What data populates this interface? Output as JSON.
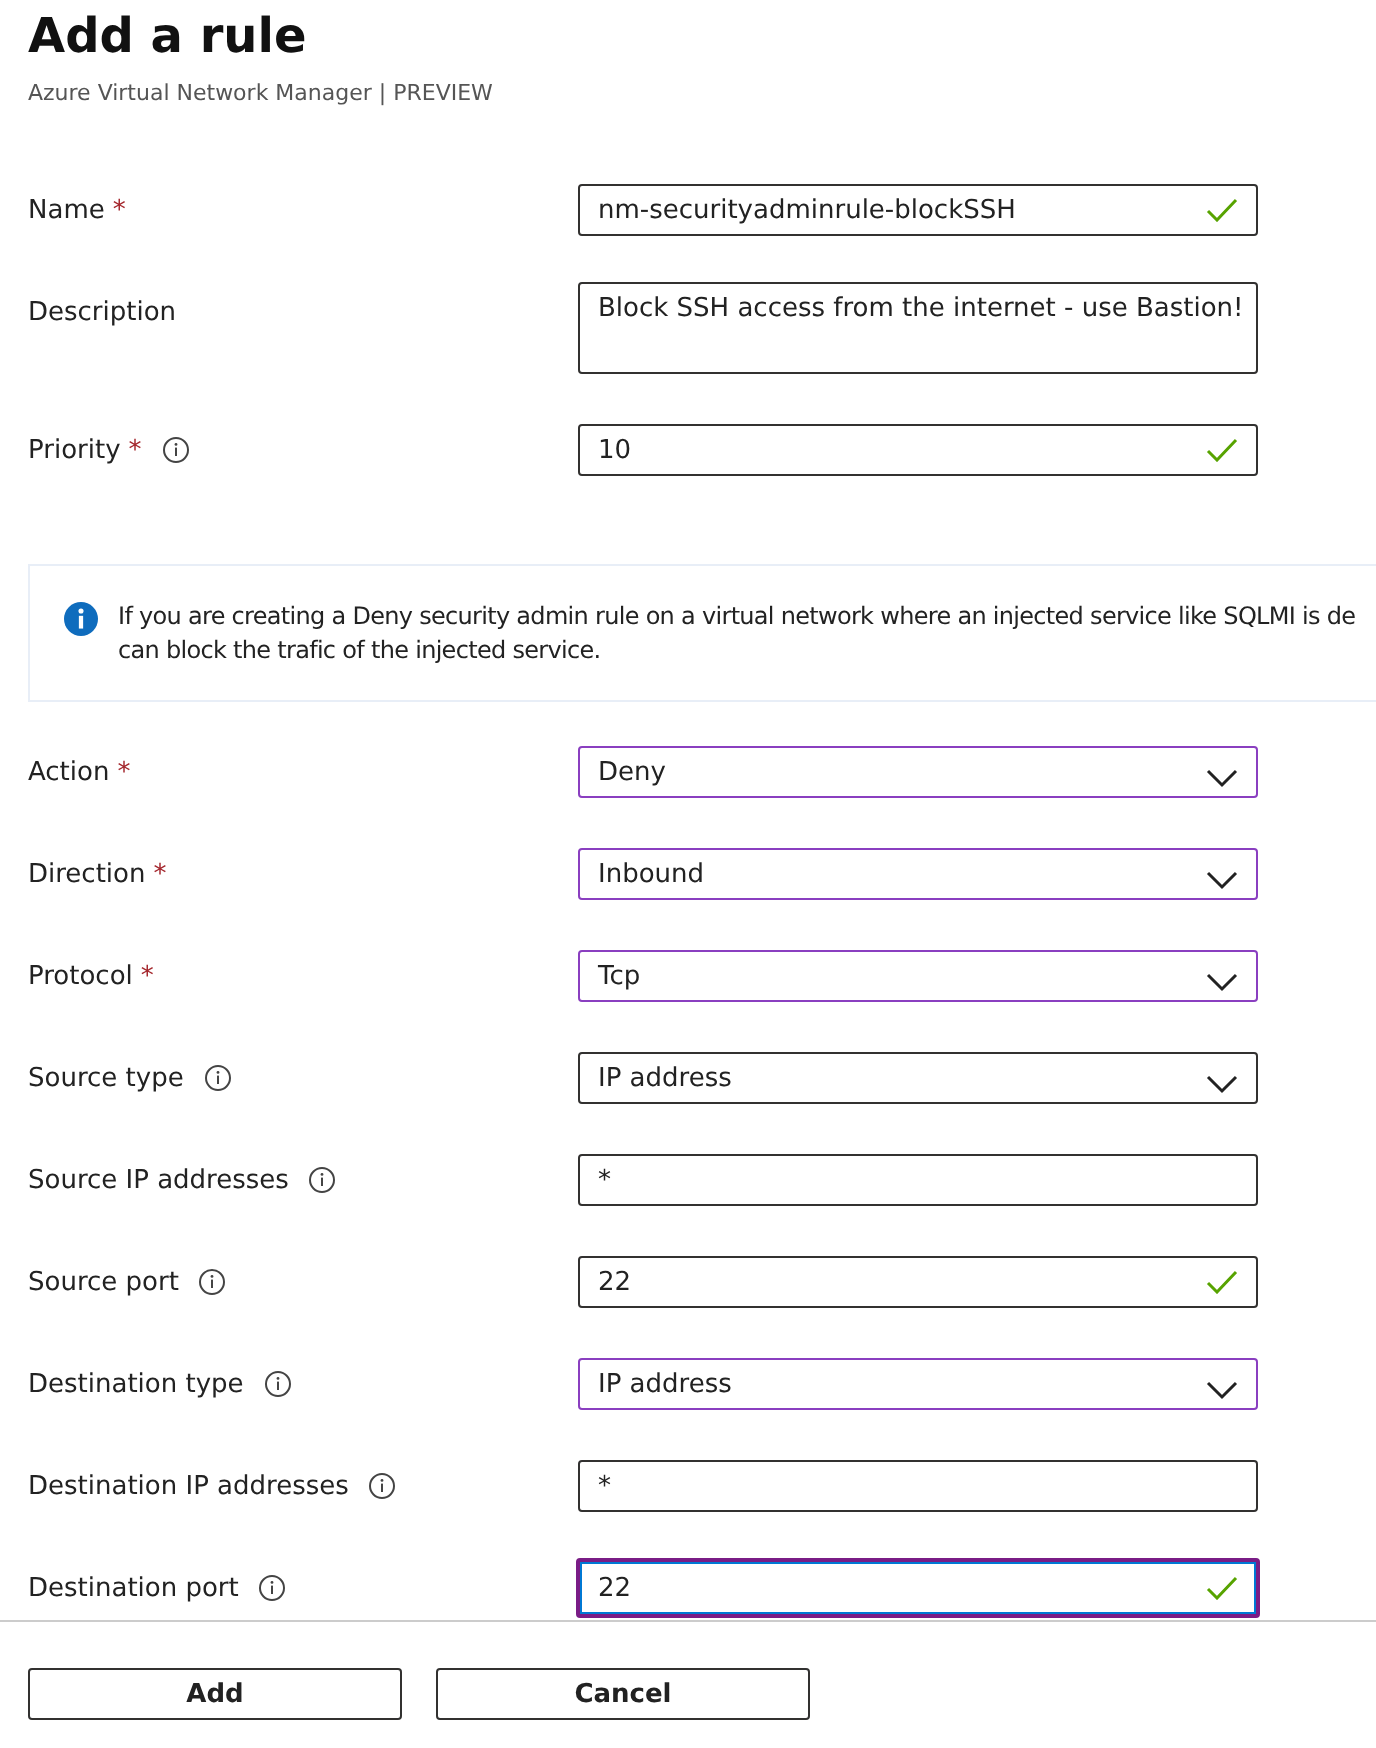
{
  "header": {
    "title": "Add a rule",
    "subtitle": "Azure Virtual Network Manager | PREVIEW"
  },
  "fields_top": [
    {
      "label": "Name",
      "kind": "text",
      "required": true,
      "info": false,
      "value": "nm-securityadminrule-blockSSH",
      "valid": true,
      "highlighted": false,
      "focused": false
    },
    {
      "label": "Description",
      "kind": "textarea",
      "required": false,
      "info": false,
      "value": "Block SSH access from the internet - use Bastion!",
      "valid": false,
      "highlighted": false,
      "focused": false
    },
    {
      "label": "Priority",
      "kind": "text",
      "required": true,
      "info": true,
      "value": "10",
      "valid": true,
      "highlighted": false,
      "focused": false
    }
  ],
  "info_banner": {
    "lines": [
      "If you are creating a Deny security admin rule on a virtual network where an injected service like SQLMI is de",
      "can block the trafic of the injected service."
    ]
  },
  "fields_bottom": [
    {
      "label": "Action",
      "kind": "select",
      "required": true,
      "info": false,
      "value": "Deny",
      "valid": false,
      "highlighted": true,
      "focused": false
    },
    {
      "label": "Direction",
      "kind": "select",
      "required": true,
      "info": false,
      "value": "Inbound",
      "valid": false,
      "highlighted": true,
      "focused": false
    },
    {
      "label": "Protocol",
      "kind": "select",
      "required": true,
      "info": false,
      "value": "Tcp",
      "valid": false,
      "highlighted": true,
      "focused": false
    },
    {
      "label": "Source type",
      "kind": "select",
      "required": false,
      "info": true,
      "value": "IP address",
      "valid": false,
      "highlighted": false,
      "focused": false
    },
    {
      "label": "Source IP addresses",
      "kind": "text",
      "required": false,
      "info": true,
      "value": "*",
      "valid": false,
      "highlighted": false,
      "focused": false
    },
    {
      "label": "Source port",
      "kind": "text",
      "required": false,
      "info": true,
      "value": "22",
      "valid": true,
      "highlighted": false,
      "focused": false
    },
    {
      "label": "Destination type",
      "kind": "select",
      "required": false,
      "info": true,
      "value": "IP address",
      "valid": false,
      "highlighted": true,
      "focused": false
    },
    {
      "label": "Destination IP addresses",
      "kind": "text",
      "required": false,
      "info": true,
      "value": "*",
      "valid": false,
      "highlighted": false,
      "focused": false
    },
    {
      "label": "Destination port",
      "kind": "text",
      "required": false,
      "info": true,
      "value": "22",
      "valid": true,
      "highlighted": false,
      "focused": true
    }
  ],
  "buttons": [
    {
      "label": "Add"
    },
    {
      "label": "Cancel"
    }
  ]
}
